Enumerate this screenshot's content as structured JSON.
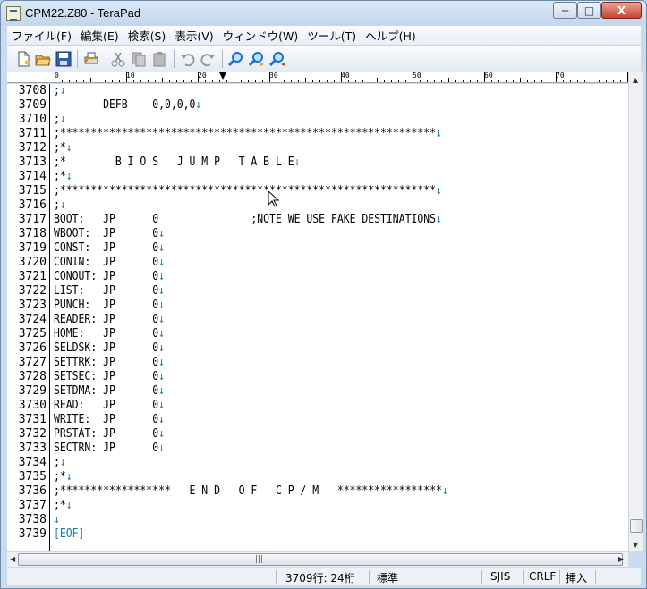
{
  "window": {
    "title": "CPM22.Z80 - TeraPad",
    "controls": {
      "minimize": "─",
      "maximize": "□",
      "close": "X"
    }
  },
  "menu": [
    "ファイル(F)",
    "編集(E)",
    "検索(S)",
    "表示(V)",
    "ウィンドウ(W)",
    "ツール(T)",
    "ヘルプ(H)"
  ],
  "toolbar": [
    {
      "icon": "new-file-icon"
    },
    {
      "icon": "open-folder-icon"
    },
    {
      "icon": "save-icon"
    },
    {
      "icon": "print-icon"
    },
    {
      "icon": "cut-icon"
    },
    {
      "icon": "copy-icon"
    },
    {
      "icon": "paste-icon"
    },
    {
      "icon": "undo-icon"
    },
    {
      "icon": "redo-icon"
    },
    {
      "icon": "find-icon"
    },
    {
      "icon": "find-next-icon"
    },
    {
      "icon": "find-prev-icon"
    }
  ],
  "ruler": {
    "labels": [
      "0",
      "10",
      "20",
      "30",
      "40",
      "50",
      "60",
      "70"
    ]
  },
  "editor": {
    "lines": [
      {
        "num": "3708",
        "text": ";",
        "nl": "↓"
      },
      {
        "num": "3709",
        "text": "        DEFB    0,0,0,0",
        "nl": "↓"
      },
      {
        "num": "3710",
        "text": ";",
        "nl": "↓"
      },
      {
        "num": "3711",
        "text": ";*************************************************************",
        "nl": "↓"
      },
      {
        "num": "3712",
        "text": ";*",
        "nl": "↓"
      },
      {
        "num": "3713",
        "text": ";*        B I O S   J U M P   T A B L E",
        "nl": "↓"
      },
      {
        "num": "3714",
        "text": ";*",
        "nl": "↓"
      },
      {
        "num": "3715",
        "text": ";*************************************************************",
        "nl": "↓"
      },
      {
        "num": "3716",
        "text": ";",
        "nl": "↓"
      },
      {
        "num": "3717",
        "text": "BOOT:   JP      0               ;NOTE WE USE FAKE DESTINATIONS",
        "nl": "↓"
      },
      {
        "num": "3718",
        "text": "WBOOT:  JP      0",
        "nl": "↓"
      },
      {
        "num": "3719",
        "text": "CONST:  JP      0",
        "nl": "↓"
      },
      {
        "num": "3720",
        "text": "CONIN:  JP      0",
        "nl": "↓"
      },
      {
        "num": "3721",
        "text": "CONOUT: JP      0",
        "nl": "↓"
      },
      {
        "num": "3722",
        "text": "LIST:   JP      0",
        "nl": "↓"
      },
      {
        "num": "3723",
        "text": "PUNCH:  JP      0",
        "nl": "↓"
      },
      {
        "num": "3724",
        "text": "READER: JP      0",
        "nl": "↓"
      },
      {
        "num": "3725",
        "text": "HOME:   JP      0",
        "nl": "↓"
      },
      {
        "num": "3726",
        "text": "SELDSK: JP      0",
        "nl": "↓"
      },
      {
        "num": "3727",
        "text": "SETTRK: JP      0",
        "nl": "↓"
      },
      {
        "num": "3728",
        "text": "SETSEC: JP      0",
        "nl": "↓"
      },
      {
        "num": "3729",
        "text": "SETDMA: JP      0",
        "nl": "↓"
      },
      {
        "num": "3730",
        "text": "READ:   JP      0",
        "nl": "↓"
      },
      {
        "num": "3731",
        "text": "WRITE:  JP      0",
        "nl": "↓"
      },
      {
        "num": "3732",
        "text": "PRSTAT: JP      0",
        "nl": "↓"
      },
      {
        "num": "3733",
        "text": "SECTRN: JP      0",
        "nl": "↓"
      },
      {
        "num": "3734",
        "text": ";",
        "nl": "↓"
      },
      {
        "num": "3735",
        "text": ";*",
        "nl": "↓"
      },
      {
        "num": "3736",
        "text": ";******************   E N D   O F   C P / M   *****************",
        "nl": "↓"
      },
      {
        "num": "3737",
        "text": ";*",
        "nl": "↓"
      },
      {
        "num": "3738",
        "text": "",
        "nl": "↓"
      },
      {
        "num": "3739",
        "text": "",
        "nl": "",
        "eof": "[EOF]"
      }
    ]
  },
  "status": {
    "position": "3709行:  24桁",
    "mode": "標準",
    "encoding": "SJIS",
    "line_ending": "CRLF",
    "insert_mode": "挿入"
  }
}
